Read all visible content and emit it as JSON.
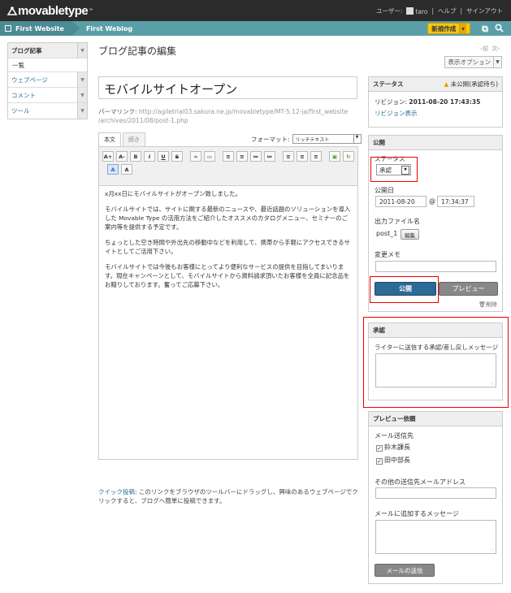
{
  "topbar": {
    "logo_text": "movabletype",
    "logo_tm": "™",
    "user_label": "ユーザー:",
    "username": "taro",
    "help": "ヘルプ",
    "signout": "サインアウト",
    "separator": "|"
  },
  "breadcrumb": {
    "website": "First Website",
    "blog": "First Weblog",
    "new_button": "新規作成",
    "dropdown": "▾"
  },
  "sidebar": {
    "items": [
      {
        "label": "ブログ記事"
      },
      {
        "label": "一覧"
      },
      {
        "label": "ウェブページ"
      },
      {
        "label": "コメント"
      },
      {
        "label": "ツール"
      }
    ],
    "arrow": "▼"
  },
  "page": {
    "title": "ブログ記事の編集",
    "prev": "‹前",
    "next": "次›",
    "view_options": "表示オプション",
    "dropdown": "▼"
  },
  "entry": {
    "title": "モバイルサイトオープン",
    "permalink_label": "パーマリンク:",
    "permalink_url_1": "http://agiletrial03.sakura.ne.jp/movabletype/MT-5.12-ja/first_website",
    "permalink_url_2": "/archives/2011/08/post-1.php",
    "tab_body": "本文",
    "tab_extended": "続き",
    "format_label": "フォーマット:",
    "format_value": "リッチテキスト",
    "dropdown": "▼",
    "toolbar": [
      "A+",
      "A-",
      "B",
      "I",
      "U",
      "S",
      "∞",
      "▭",
      "≡",
      "≡",
      "≔",
      "≔",
      "≡",
      "≡",
      "≡",
      "▣",
      "↻",
      "A",
      "A"
    ],
    "paragraphs": [
      "x月xx日にモバイルサイトがオープン致しました。",
      "モバイルサイトでは、サイトに関する最新のニュースや、最近話題のソリューションを導入した Movable Type の活用方法をご紹介したオススメのカタログメニュー、セミナーのご案内等を提供する予定です。",
      "ちょっとした空き時間や外出先の移動中などを利用して、携帯から手軽にアクセスできるサイトとしてご活用下さい。",
      "モバイルサイトでは今後もお客様にとってより便利なサービスの提供を目指してまいります。現在キャンペーンとして、モバイルサイトから資料請求頂いたお客様を全員に記念品をお贈りしております。奮ってご応募下さい。"
    ],
    "quickpost_link": "クイック投稿",
    "quickpost_text": ": このリンクをブラウザのツールバーにドラッグし、興味のあるウェブページでクリックすると、ブログへ簡単に投稿できます。"
  },
  "status_widget": {
    "title": "ステータス",
    "status": "未公開(承認待ち)",
    "warn_icon": "▲",
    "revision_label": "リビジョン:",
    "revision_value": "2011-08-20 17:43:35",
    "revision_link": "リビジョン表示"
  },
  "publish_widget": {
    "title": "公開",
    "status_label": "ステータス",
    "status_value": "承認",
    "date_label": "公開日",
    "date_value": "2011-08-20",
    "at": "@",
    "time_value": "17:34:37",
    "output_label": "出力ファイル名",
    "output_value": "post_1",
    "edit_button": "編集",
    "memo_label": "変更メモ",
    "publish_button": "公開",
    "preview_button": "プレビュー",
    "delete": "削除"
  },
  "approval_widget": {
    "title": "承認",
    "label": "ライターに送信する承認/差し戻しメッセージ",
    "grip": ".::"
  },
  "preview_request_widget": {
    "title": "プレビュー依頼",
    "recipient_label": "メール送信先",
    "recipients": [
      "鈴木課長",
      "田中部長"
    ],
    "checkmark": "✓",
    "other_label": "その他の送信先メールアドレス",
    "message_label": "メールに追加するメッセージ",
    "send_button": "メールの送信"
  }
}
